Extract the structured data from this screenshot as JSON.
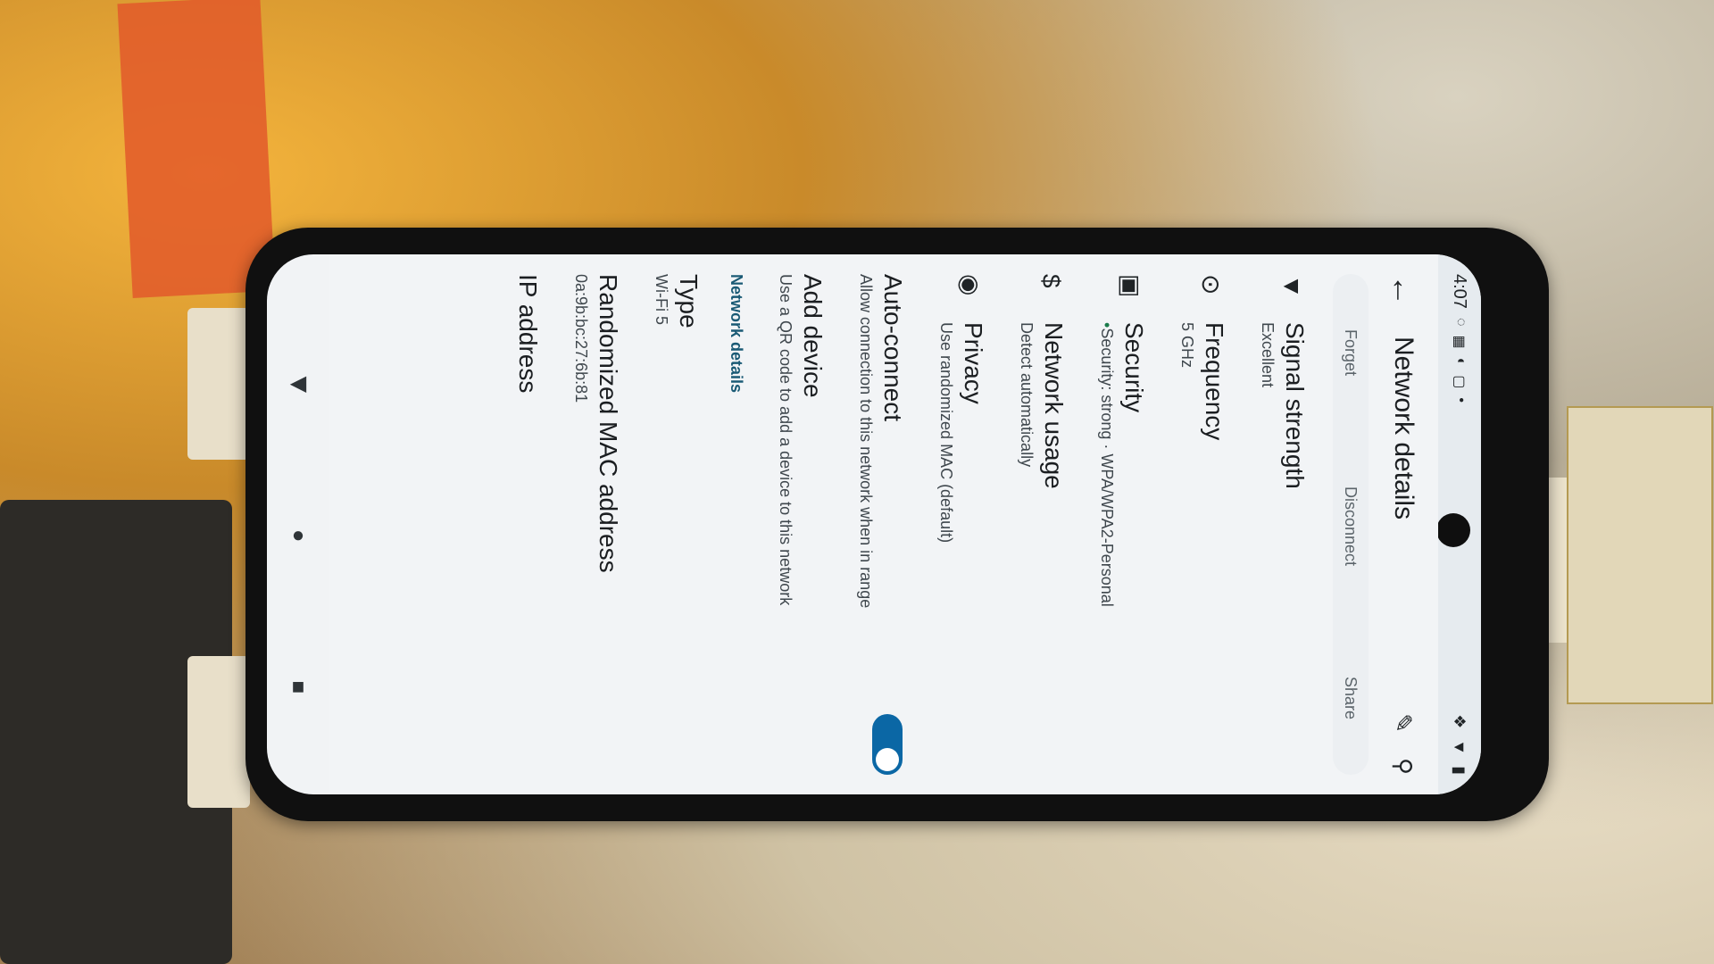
{
  "status_bar": {
    "time": "4:07"
  },
  "top_appbar": {
    "title": "Network details"
  },
  "action_row": {
    "forget": "Forget",
    "disconnect": "Disconnect",
    "share": "Share"
  },
  "list": [
    {
      "icon": "wifi-signal-icon",
      "title": "Signal strength",
      "subtitle": "Excellent"
    },
    {
      "icon": "radio-tower-icon",
      "title": "Frequency",
      "subtitle": "5 GHz"
    },
    {
      "icon": "lock-icon",
      "title": "Security",
      "subtitle": "Security: strong · WPA/WPA2-Personal"
    },
    {
      "icon": "dollar-icon",
      "title": "Network usage",
      "subtitle": "Detect automatically"
    },
    {
      "icon": "privacy-icon",
      "title": "Privacy",
      "subtitle": "Use randomized MAC (default)"
    },
    {
      "icon": "",
      "title": "Auto-connect",
      "subtitle": "Allow connection to this network when in range"
    },
    {
      "icon": "",
      "title": "Add device",
      "subtitle": "Use a QR code to add a device to this network"
    }
  ],
  "section": {
    "header": "Network details",
    "items": [
      {
        "title": "Type",
        "subtitle": "Wi-Fi 5"
      },
      {
        "title": "Randomized MAC address",
        "subtitle": "0a:9b:bc:27:6b:81"
      },
      {
        "title": "IP address",
        "subtitle": ""
      }
    ]
  },
  "toggles": {
    "auto_connect": true
  },
  "colors": {
    "accent": "#0b67a5",
    "section_header": "#1a5a75"
  }
}
